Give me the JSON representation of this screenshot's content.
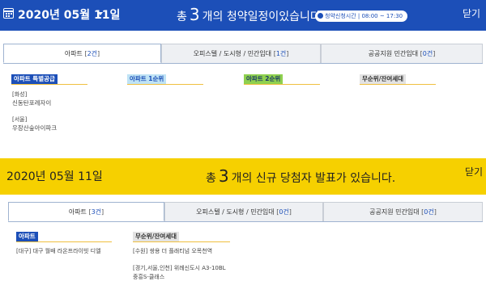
{
  "section1": {
    "date": "2020년 05월 11일",
    "msg_pre": "총",
    "count": "3",
    "msg_post": "개의 청약일정이있습니다.",
    "hours": "청약신청시간 | 08:00 ~ 17:30",
    "close": "닫기",
    "tabs": [
      {
        "label": "아파트",
        "count": "2건"
      },
      {
        "label": "오피스텔 / 도시형 / 민간임대",
        "count": "1건"
      },
      {
        "label": "공공지원 민간임대",
        "count": "0건"
      }
    ],
    "categories": [
      {
        "label": "아파트 특별공급",
        "entries": [
          {
            "region": "[화성]",
            "name": "신동탄포레자이"
          },
          {
            "region": "[서울]",
            "name": "우장산숲아이파크"
          }
        ]
      },
      {
        "label": "아파트 1순위"
      },
      {
        "label": "아파트 2순위"
      },
      {
        "label": "무순위/잔여세대"
      }
    ]
  },
  "section2": {
    "date": "2020년 05월 11일",
    "msg_pre": "총",
    "count": "3",
    "msg_post": "개의 신규 당첨자 발표가 있습니다.",
    "close": "닫기",
    "tabs": [
      {
        "label": "아파트",
        "count": "3건"
      },
      {
        "label": "오피스텔 / 도시형 / 민간임대",
        "count": "0건"
      },
      {
        "label": "공공지원 민간임대",
        "count": "0건"
      }
    ],
    "categories": [
      {
        "label": "아파트",
        "entries": [
          {
            "text": "[대구] 대구 월배 라온프라이빗 디엘"
          }
        ]
      },
      {
        "label": "무순위/잔여세대",
        "entries": [
          {
            "text": "[수원] 쌍용 더 플래티넘 오목천역"
          },
          {
            "text": "[경기,서울,인천] 위례신도시 A3-10BL"
          },
          {
            "text": "중흥S-클래스"
          }
        ]
      }
    ]
  },
  "colors": {
    "blue_header": "#1c4fb8",
    "yellow_header": "#f6d000",
    "cat_special": "#1c4fb8",
    "cat_first": "#bfe3f5",
    "cat_second": "#8fd14f",
    "cat_norank": "#e3e3e3",
    "cat_line": "#f0c040"
  }
}
